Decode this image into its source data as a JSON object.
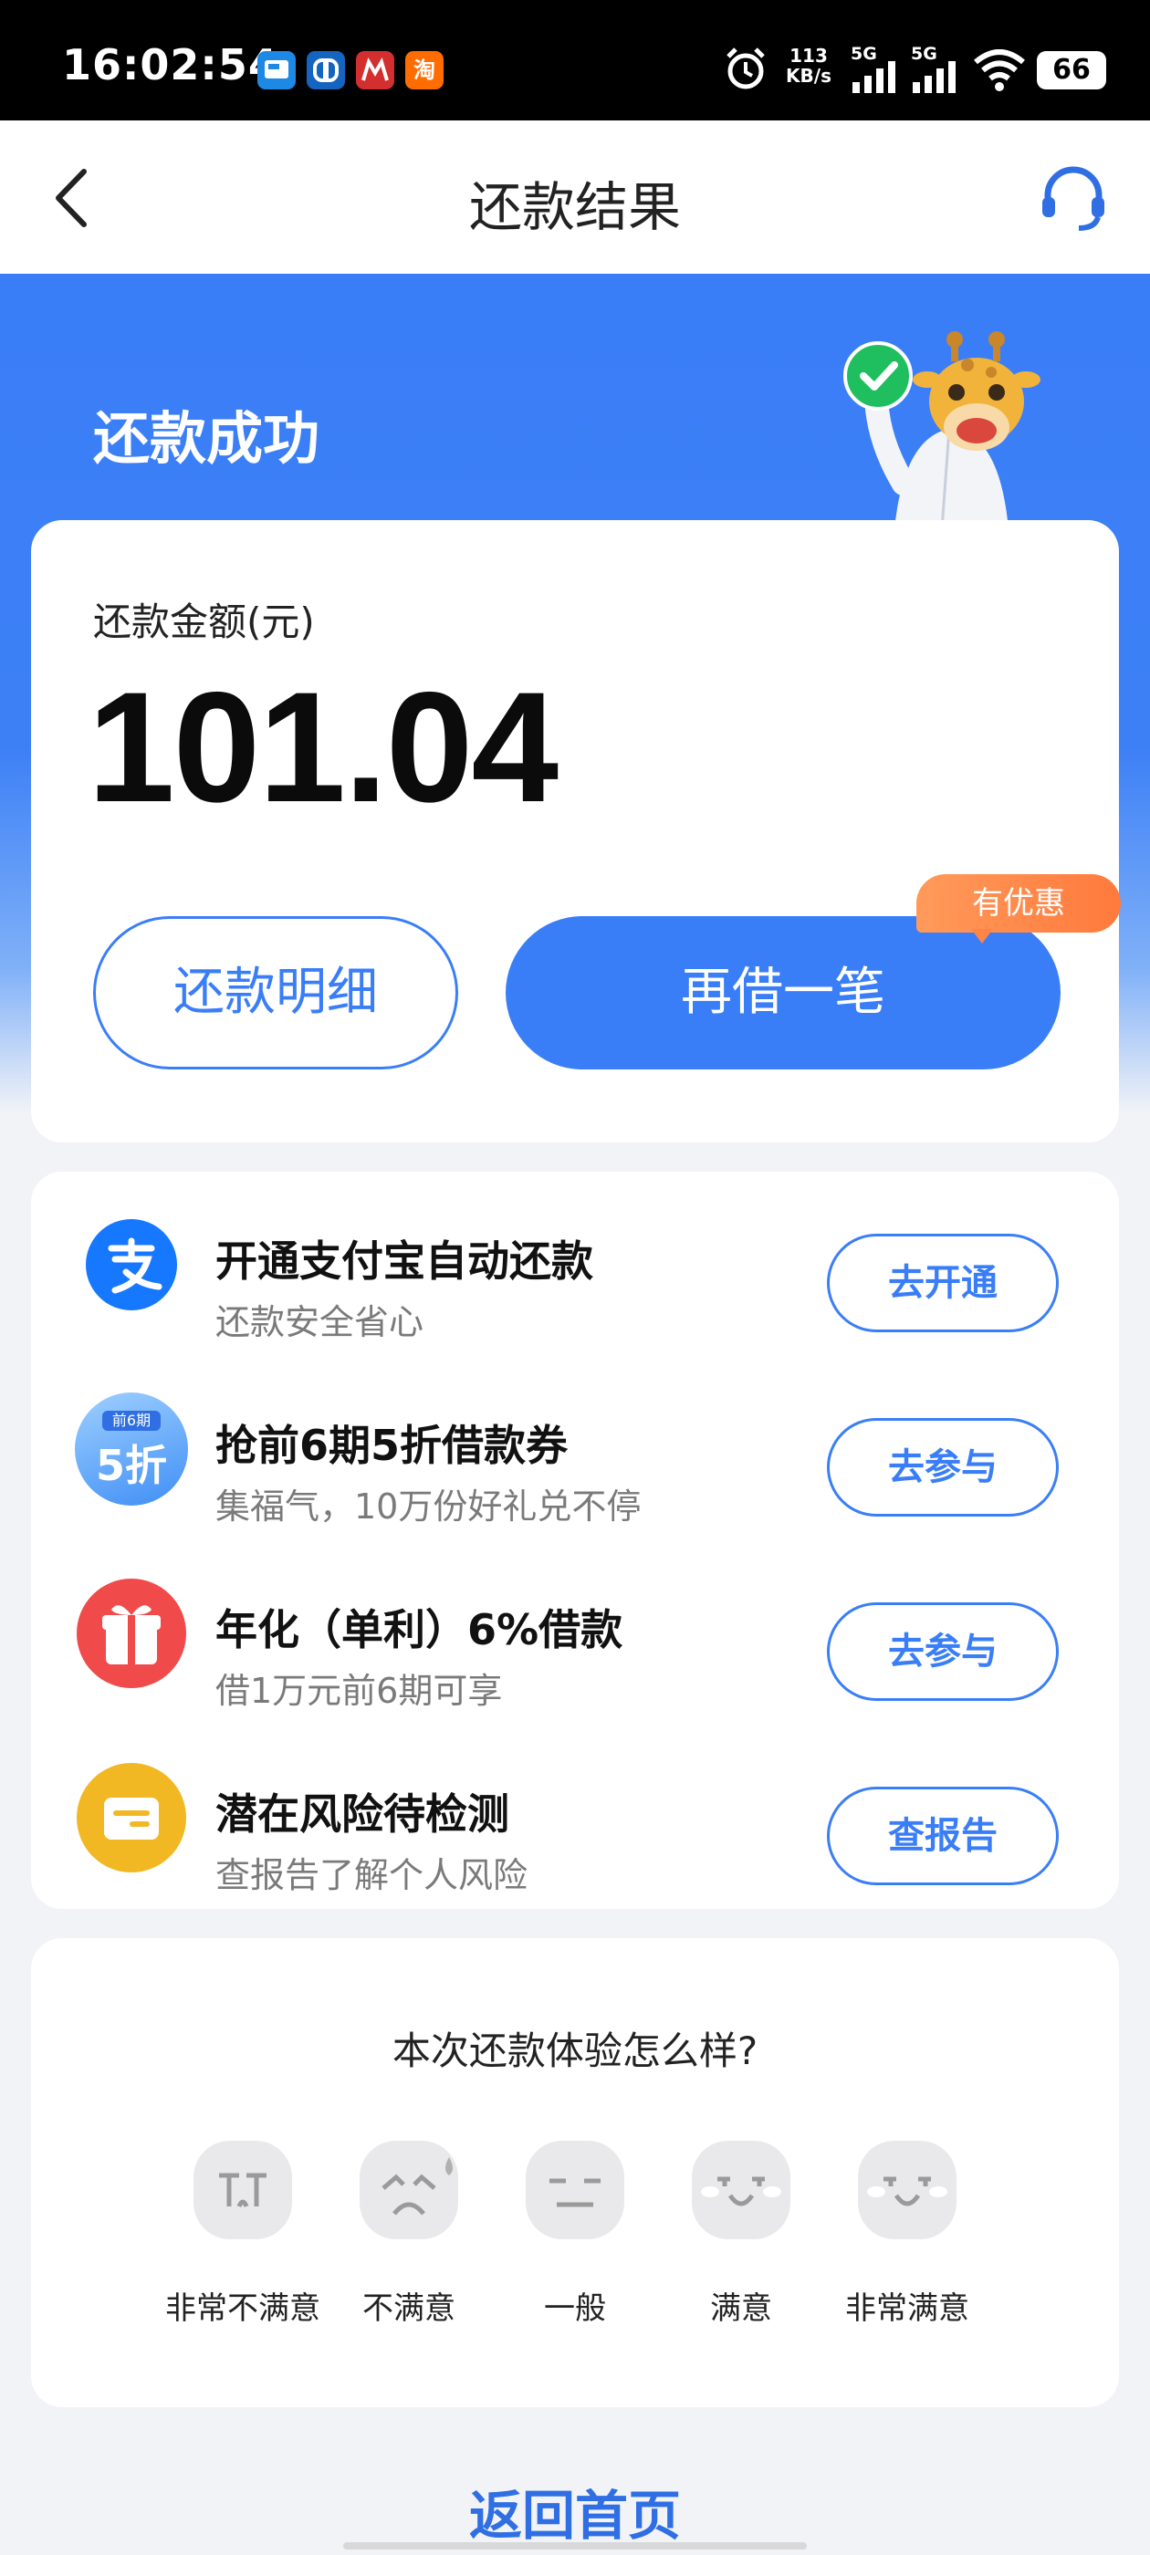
{
  "status_bar": {
    "time": "16:02:54",
    "net_speed_value": "113",
    "net_speed_unit": "KB/s",
    "signal1": "5G",
    "signal2": "5G",
    "battery": "66",
    "app_icons": [
      "",
      "",
      "",
      "淘"
    ]
  },
  "header": {
    "title": "还款结果"
  },
  "banner": {
    "title": "还款成功"
  },
  "result": {
    "amount_label": "还款金额(元)",
    "amount_value": "101.04",
    "detail_button": "还款明细",
    "borrow_button": "再借一笔",
    "promo_badge": "有优惠"
  },
  "services": [
    {
      "title": "开通支付宝自动还款",
      "subtitle": "还款安全省心",
      "button": "去开通",
      "icon": "alipay-icon"
    },
    {
      "title": "抢前6期5折借款券",
      "subtitle": "集福气，10万份好礼兑不停",
      "button": "去参与",
      "icon": "discount-coupon-icon",
      "icon_top": "前6期",
      "icon_main": "5折"
    },
    {
      "title": "年化（单利）6%借款",
      "subtitle": "借1万元前6期可享",
      "button": "去参与",
      "icon": "gift-icon"
    },
    {
      "title": "潜在风险待检测",
      "subtitle": "查报告了解个人风险",
      "button": "查报告",
      "icon": "report-card-icon"
    }
  ],
  "feedback": {
    "question": "本次还款体验怎么样?",
    "options": [
      "非常不满意",
      "不满意",
      "一般",
      "满意",
      "非常满意"
    ]
  },
  "footer": {
    "home_link": "返回首页"
  },
  "colors": {
    "primary": "#3a7ef7",
    "promo": "#ff8446",
    "alipay": "#1677ff",
    "gift": "#f04a4a",
    "report": "#f2b824"
  }
}
